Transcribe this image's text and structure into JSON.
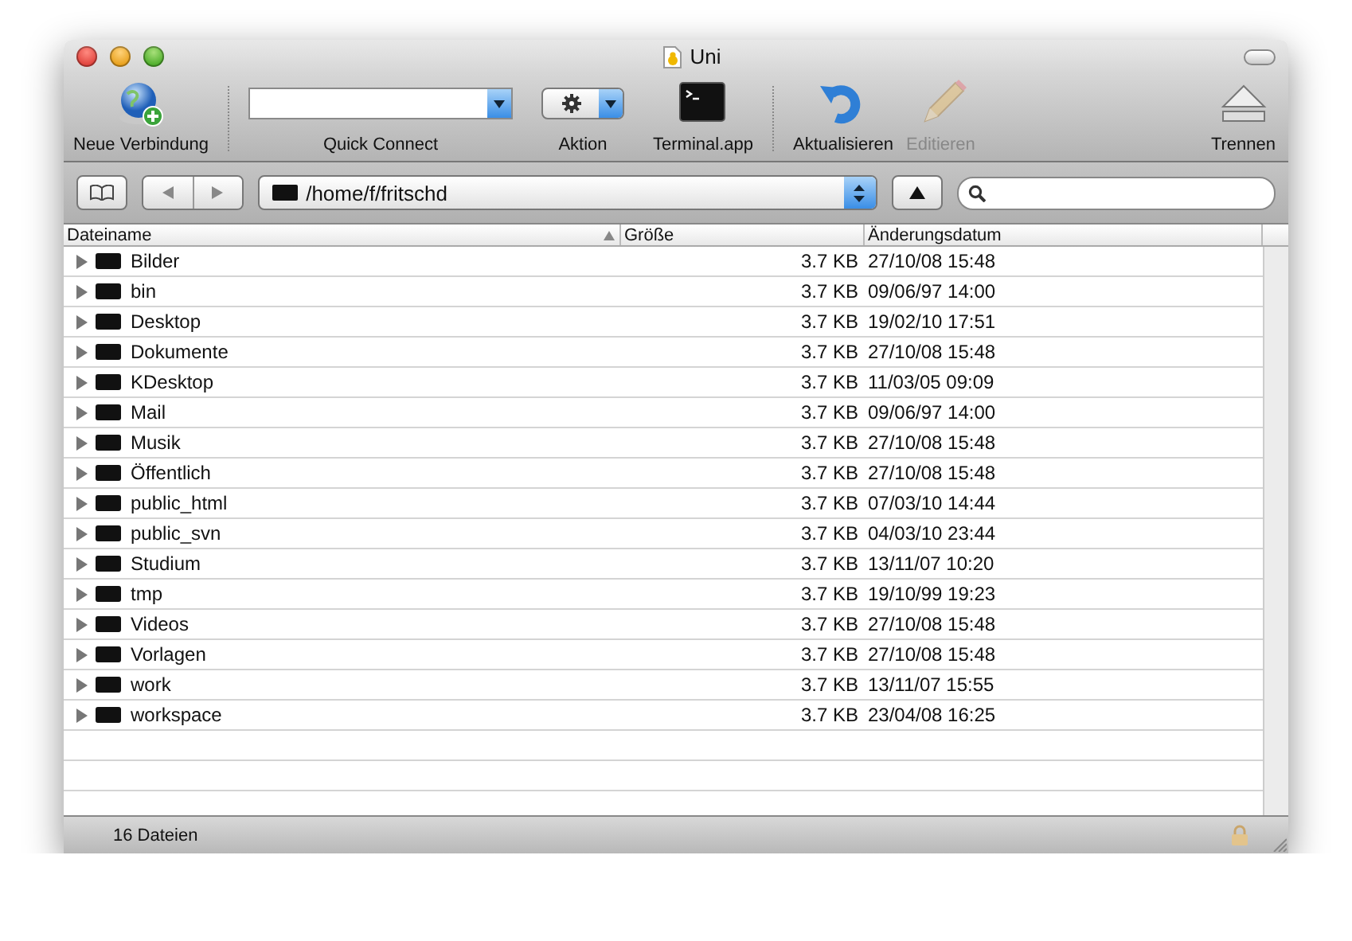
{
  "window": {
    "title": "Uni"
  },
  "toolbar": [
    {
      "kind": "button",
      "label": "Neue Verbindung",
      "disabled": false
    },
    {
      "kind": "separator"
    },
    {
      "kind": "combo",
      "label": "Quick Connect"
    },
    {
      "kind": "popup",
      "label": "Aktion"
    },
    {
      "kind": "button",
      "label": "Terminal.app",
      "disabled": false
    },
    {
      "kind": "separator"
    },
    {
      "kind": "button",
      "label": "Aktualisieren",
      "disabled": false
    },
    {
      "kind": "button",
      "label": "Editieren",
      "disabled": true
    },
    {
      "kind": "spacer"
    },
    {
      "kind": "button",
      "label": "Trennen",
      "disabled": false
    }
  ],
  "path": "/home/f/fritschd",
  "table": {
    "columns": [
      {
        "label": "Dateiname",
        "sorted": true
      },
      {
        "label": "Größe",
        "sorted": false
      },
      {
        "label": "Änderungsdatum",
        "sorted": false
      }
    ],
    "rows": [
      {
        "name": "Bilder",
        "size": "3.7 KB",
        "modified": "27/10/08 15:48"
      },
      {
        "name": "bin",
        "size": "3.7 KB",
        "modified": "09/06/97 14:00"
      },
      {
        "name": "Desktop",
        "size": "3.7 KB",
        "modified": "19/02/10 17:51"
      },
      {
        "name": "Dokumente",
        "size": "3.7 KB",
        "modified": "27/10/08 15:48"
      },
      {
        "name": "KDesktop",
        "size": "3.7 KB",
        "modified": "11/03/05 09:09"
      },
      {
        "name": "Mail",
        "size": "3.7 KB",
        "modified": "09/06/97 14:00"
      },
      {
        "name": "Musik",
        "size": "3.7 KB",
        "modified": "27/10/08 15:48"
      },
      {
        "name": "Öffentlich",
        "size": "3.7 KB",
        "modified": "27/10/08 15:48"
      },
      {
        "name": "public_html",
        "size": "3.7 KB",
        "modified": "07/03/10 14:44"
      },
      {
        "name": "public_svn",
        "size": "3.7 KB",
        "modified": "04/03/10 23:44"
      },
      {
        "name": "Studium",
        "size": "3.7 KB",
        "modified": "13/11/07 10:20"
      },
      {
        "name": "tmp",
        "size": "3.7 KB",
        "modified": "19/10/99 19:23"
      },
      {
        "name": "Videos",
        "size": "3.7 KB",
        "modified": "27/10/08 15:48"
      },
      {
        "name": "Vorlagen",
        "size": "3.7 KB",
        "modified": "27/10/08 15:48"
      },
      {
        "name": "work",
        "size": "3.7 KB",
        "modified": "13/11/07 15:55"
      },
      {
        "name": "workspace",
        "size": "3.7 KB",
        "modified": "23/04/08 16:25"
      }
    ]
  },
  "status_bar": {
    "text": "16 Dateien"
  }
}
